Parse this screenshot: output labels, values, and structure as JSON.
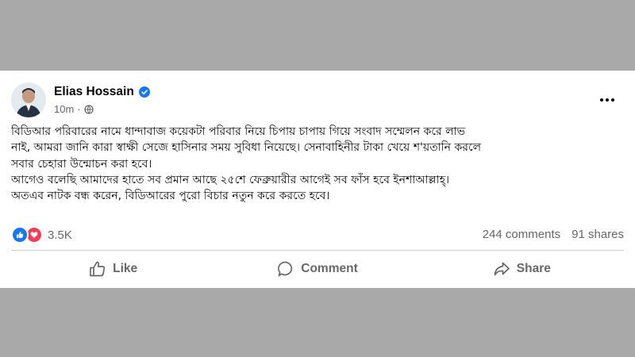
{
  "post": {
    "author": "Elias Hossain",
    "time": "10m",
    "body_lines": [
      "বিডিআর পরিবারের নামে ধান্দাবাজ কয়েকটা পরিবার নিয়ে চিপায় চাপায় গিয়ে সংবাদ সম্মেলন করে লাভ",
      "নাই, আমরা জানি কারা স্বাক্ষী সেজে হাসিনার সময় সুবিধা নিয়েছে। সেনাবাহিনীর টাকা খেয়ে শ'য়তানি করলে",
      "সবার চেহারা উন্মোচন করা হবে।",
      "আগেও বলেছি আমাদের হাতে সব প্রমান আছে ২৫শে ফেব্রুয়ারীর আগেই সব ফাঁস হবে ইনশাআল্লাহ্।",
      "অতএব নাটক বন্ধ করেন, বিডিআরের পুরো বিচার নতুন করে করতে হবে।"
    ],
    "reaction_count": "3.5K",
    "comments": "244 comments",
    "shares": "91 shares"
  },
  "actions": {
    "like": "Like",
    "comment": "Comment",
    "share": "Share"
  },
  "colors": {
    "background": "#a9a9a9",
    "card": "#ffffff",
    "brand_blue": "#1877f2",
    "love_red": "#f33e58",
    "secondary_text": "#65676b"
  },
  "icons": [
    "avatar",
    "verified-badge-icon",
    "globe-icon",
    "more-options-icon",
    "like-reaction-icon",
    "love-reaction-icon",
    "thumbs-up-icon",
    "comment-bubble-icon",
    "share-arrow-icon"
  ]
}
